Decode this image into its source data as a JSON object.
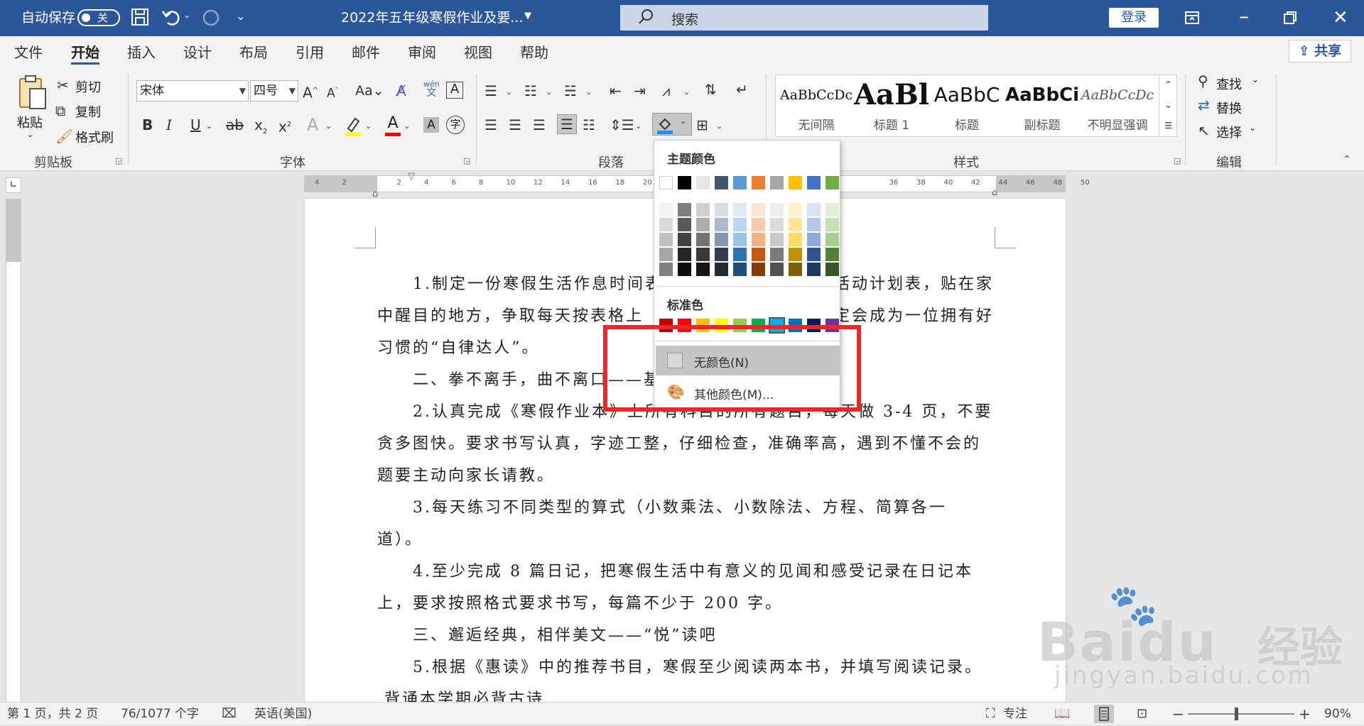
{
  "titlebar": {
    "autosave_label": "自动保存",
    "autosave_state": "关",
    "doc_title": "2022年五年级寒假作业及要...",
    "search_placeholder": "搜索",
    "login_label": "登录",
    "bg_color": "#2b579a"
  },
  "menu": {
    "tabs": [
      "文件",
      "开始",
      "插入",
      "设计",
      "布局",
      "引用",
      "邮件",
      "审阅",
      "视图",
      "帮助"
    ],
    "active_tab": "开始",
    "share_label": "共享"
  },
  "ribbon": {
    "clipboard": {
      "paste": "粘贴",
      "cut": "剪切",
      "copy": "复制",
      "format_painter": "格式刷",
      "group_label": "剪贴板"
    },
    "font": {
      "font_name": "宋体",
      "font_size": "四号",
      "group_label": "字体",
      "phonetic_top": "wén",
      "phonetic_bottom": "文"
    },
    "paragraph": {
      "group_label": "段落"
    },
    "styles": {
      "group_label": "样式",
      "items": [
        {
          "preview": "AaBbCcDc",
          "name": "无间隔"
        },
        {
          "preview": "AaBl",
          "name": "标题 1"
        },
        {
          "preview": "AaBbC",
          "name": "标题"
        },
        {
          "preview": "AaBbCi",
          "name": "副标题"
        },
        {
          "preview": "AaBbCcDc",
          "name": "不明显强调"
        }
      ]
    },
    "editing": {
      "find": "查找",
      "replace": "替换",
      "select": "选择",
      "group_label": "编辑"
    }
  },
  "shading_dropdown": {
    "theme_header": "主题颜色",
    "standard_header": "标准色",
    "theme_top": [
      "#ffffff",
      "#000000",
      "#e7e6e6",
      "#44546a",
      "#5b9bd5",
      "#ed7d31",
      "#a5a5a5",
      "#ffc000",
      "#4472c4",
      "#70ad47"
    ],
    "theme_shades": [
      [
        "#f2f2f2",
        "#d9d9d9",
        "#bfbfbf",
        "#a6a6a6",
        "#808080"
      ],
      [
        "#7f7f7f",
        "#595959",
        "#404040",
        "#262626",
        "#0d0d0d"
      ],
      [
        "#d0cece",
        "#afabab",
        "#767171",
        "#3a3838",
        "#171616"
      ],
      [
        "#d6dce4",
        "#adb9ca",
        "#8496b0",
        "#333f4f",
        "#222a35"
      ],
      [
        "#deebf6",
        "#bdd7ee",
        "#9dc3e6",
        "#2e75b5",
        "#1f4e79"
      ],
      [
        "#fbe5d5",
        "#f7caac",
        "#f4b183",
        "#c55a11",
        "#843c0b"
      ],
      [
        "#ededed",
        "#dbdbdb",
        "#c9c9c9",
        "#7b7b7b",
        "#525252"
      ],
      [
        "#fff2cc",
        "#fee599",
        "#ffd965",
        "#bf9000",
        "#7f6000"
      ],
      [
        "#dae3f3",
        "#b4c7e7",
        "#8faadc",
        "#2f5496",
        "#1f3864"
      ],
      [
        "#e2efd9",
        "#c5e0b3",
        "#a8d08d",
        "#538135",
        "#375623"
      ]
    ],
    "standard": [
      "#c00000",
      "#ff0000",
      "#ffc000",
      "#ffff00",
      "#92d050",
      "#00b050",
      "#00b0f0",
      "#0070c0",
      "#002060",
      "#7030a0"
    ],
    "no_color": "无颜色(N)",
    "more_colors": "其他颜色(M)..."
  },
  "document": {
    "lines": [
      "1.制定一份寒假生活作息时间表",
      "活动计划表，贴在家",
      "中醒目的地方，争取每天按表格上",
      "定会成为一位拥有好",
      "习惯的“自律达人”。",
      "二、拳不离手，曲不离口——基",
      "2.认真完成《寒假作业本》上所有科目的所有题目，每天做 3-4 页，不要",
      "贪多图快。要求书写认真，字迹工整，仔细检查，准确率高，遇到不懂不会的",
      "题要主动向家长请教。",
      "3.每天练习不同类型的算式（小数乘法、小数除法、方程、简算各一",
      "道）。",
      "4.至少完成 8 篇日记，把寒假生活中有意义的见闻和感受记录在日记本",
      "上，要求按照格式要求书写，每篇不少于 200 字。",
      "三、邂逅经典，相伴美文——“悦”读吧",
      "5.根据《惠读》中的推荐书目，寒假至少阅读两本书，并填写阅读记录。",
      "背诵本学期必背古诗"
    ],
    "ruler_numbers": [
      "4",
      "2",
      "",
      "2",
      "4",
      "6",
      "8",
      "10",
      "12",
      "14",
      "16",
      "18",
      "20",
      "",
      "",
      "",
      "",
      "",
      "",
      "",
      "",
      "36",
      "38",
      "40",
      "42",
      "44",
      "46",
      "48",
      "50"
    ]
  },
  "status": {
    "page": "第 1 页，共 2 页",
    "words": "76/1077 个字",
    "language": "英语(美国)",
    "focus": "专注",
    "zoom": "90%",
    "zoom_minus": "−",
    "zoom_plus": "+"
  },
  "watermark": {
    "brand": "Baidu",
    "cn": "经验",
    "url": "jingyan.baidu.com"
  },
  "highlight_color": "#e8282b"
}
